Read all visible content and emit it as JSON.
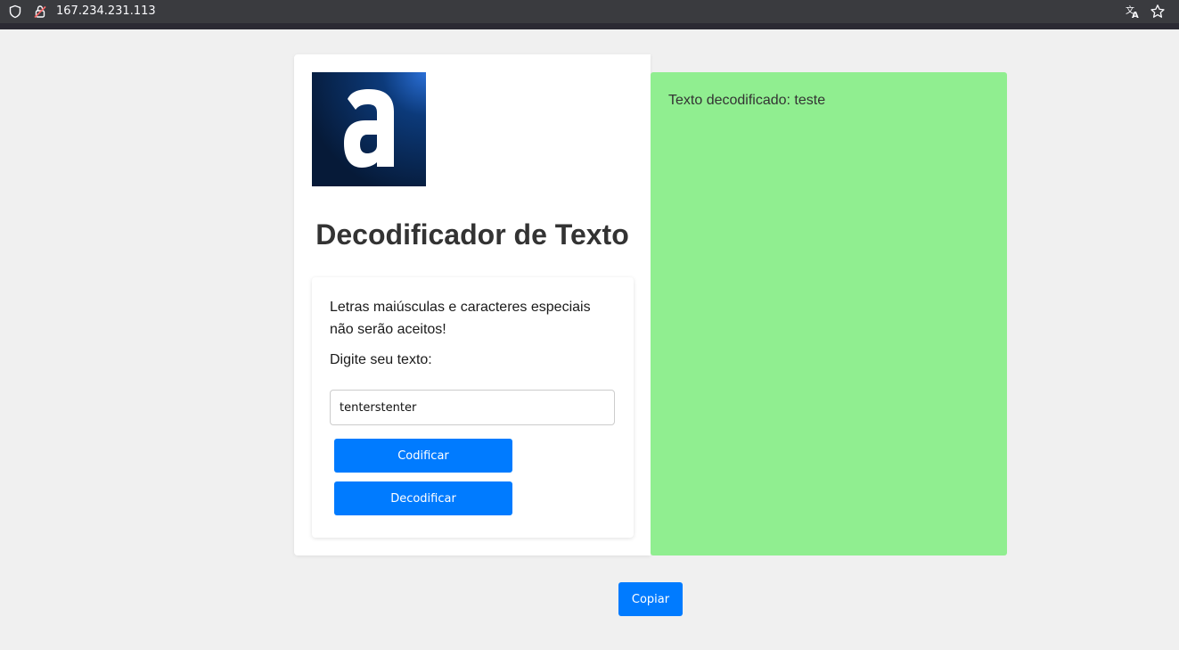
{
  "browser": {
    "url": "167.234.231.113",
    "icons": [
      "shield-icon",
      "lock-warning-icon",
      "translate-icon",
      "bookmark-star-icon"
    ]
  },
  "app": {
    "logo_letter": "a",
    "title": "Decodificador de Texto",
    "warning": "Letras maiúsculas e caracteres especiais não serão aceitos!",
    "prompt": "Digite seu texto:",
    "input_value": "tenterstenter",
    "encode_label": "Codificar",
    "decode_label": "Decodificar",
    "result_prefix": "Texto decodificado: ",
    "result_value": "teste",
    "copy_label": "Copiar"
  },
  "colors": {
    "page_background": "#f0f0f0",
    "button_primary": "#007bff",
    "result_panel": "#90ee90",
    "title_text": "#333333",
    "logo_background": "#0a1f3d"
  }
}
